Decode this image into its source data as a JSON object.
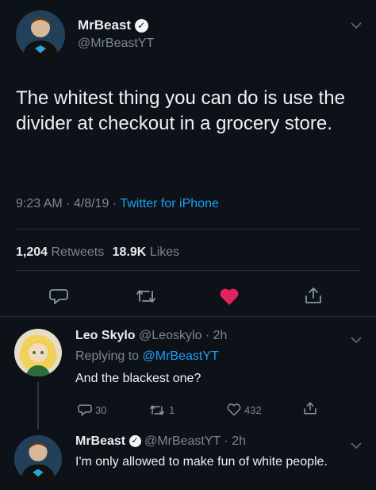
{
  "main_tweet": {
    "name": "MrBeast",
    "handle": "@MrBeastYT",
    "text": "The whitest thing you can do is use the divider at checkout in a grocery store.",
    "time": "9:23 AM",
    "date": "4/8/19",
    "source": "Twitter for iPhone",
    "retweets_count": "1,204",
    "retweets_label": "Retweets",
    "likes_count": "18.9K",
    "likes_label": "Likes",
    "liked": true
  },
  "reply_1": {
    "name": "Leo Skylo",
    "handle": "@Leoskylo",
    "age": "2h",
    "replying_prefix": "Replying to",
    "replying_to": "@MrBeastYT",
    "text": "And the blackest one?",
    "reply_count": "30",
    "retweet_count": "1",
    "like_count": "432"
  },
  "reply_2": {
    "name": "MrBeast",
    "handle": "@MrBeastYT",
    "age": "2h",
    "text": "I'm only allowed to make fun of white people."
  },
  "colors": {
    "background": "#0d1118",
    "accent": "#1da1f2",
    "like": "#e0245e",
    "muted": "#7b8794"
  },
  "icons": [
    "verified-icon",
    "chevron-down-icon",
    "reply-icon",
    "retweet-icon",
    "heart-icon",
    "share-icon"
  ]
}
